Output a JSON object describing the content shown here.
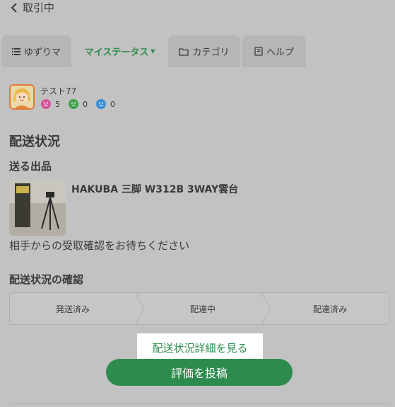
{
  "header": {
    "back_label": "取引中"
  },
  "tabs": [
    {
      "label": "ゆずりマ",
      "icon": "list-icon",
      "active": false
    },
    {
      "label": "マイステータス",
      "icon": "",
      "active": true
    },
    {
      "label": "カテゴリ",
      "icon": "folder-icon",
      "active": false
    },
    {
      "label": "ヘルプ",
      "icon": "book-icon",
      "active": false
    }
  ],
  "user": {
    "name": "テスト77",
    "ratings": [
      {
        "kind": "good",
        "count": "5",
        "color": "#d6569e"
      },
      {
        "kind": "normal",
        "count": "0",
        "color": "#3fa34d"
      },
      {
        "kind": "bad",
        "count": "0",
        "color": "#3c8fd6"
      }
    ]
  },
  "shipping": {
    "heading": "配送状況",
    "product_heading": "送る出品",
    "product_title": "HAKUBA 三脚 W312B 3WAY雲台",
    "notice": "相手からの受取確認をお待ちください",
    "check_heading": "配送状況の確認",
    "steps": [
      "発送済み",
      "配達中",
      "配達済み"
    ],
    "detail_link": "配送状況詳細を見る",
    "post_button": "評価を投稿"
  },
  "colors": {
    "accent": "#2e8b4e",
    "background": "#c2c2c2"
  }
}
